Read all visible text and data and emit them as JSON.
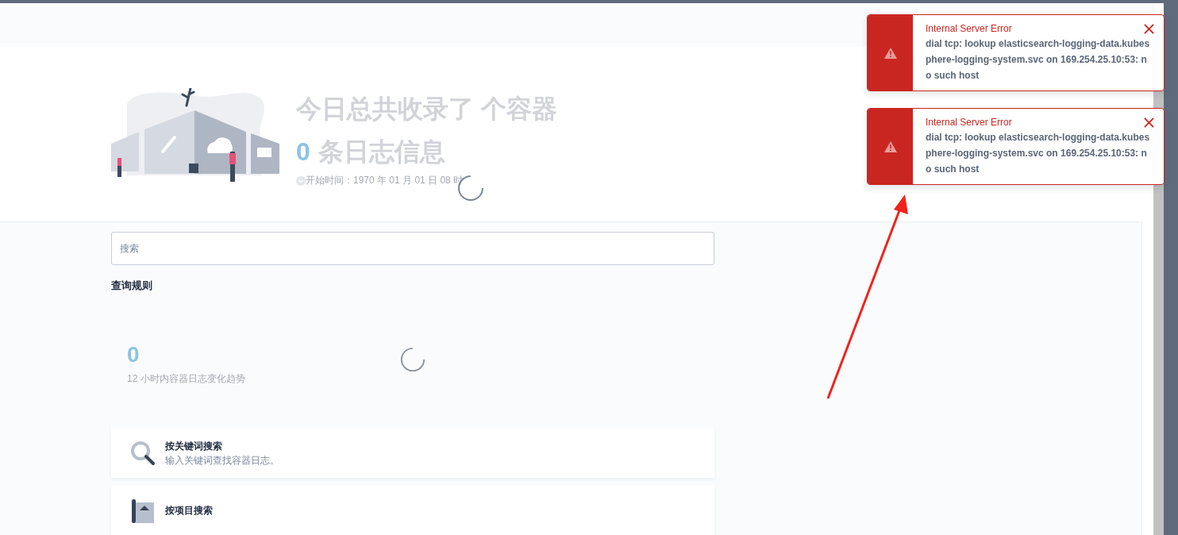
{
  "hero": {
    "title": "今日总共收录了 个容器",
    "log_count": "0",
    "log_label": "条日志信息",
    "start_time": "开始时间：1970 年 01 月 01 日 08 时"
  },
  "search": {
    "placeholder": "搜索"
  },
  "rules_title": "查询规则",
  "trend": {
    "count": "0",
    "label": "12 小时内容器日志变化趋势"
  },
  "rules": [
    {
      "kind": "keyword",
      "title": "按关键词搜索",
      "description": "输入关键词查找容器日志。"
    },
    {
      "kind": "project",
      "title": "按项目搜索"
    }
  ],
  "notifications": [
    {
      "title": "Internal Server Error",
      "message": "dial tcp: lookup elasticsearch-logging-data.kubesphere-logging-system.svc on 169.254.25.10:53: no such host"
    },
    {
      "title": "Internal Server Error",
      "message": "dial tcp: lookup elasticsearch-logging-data.kubesphere-logging-system.svc on 169.254.25.10:53: no such host"
    }
  ]
}
